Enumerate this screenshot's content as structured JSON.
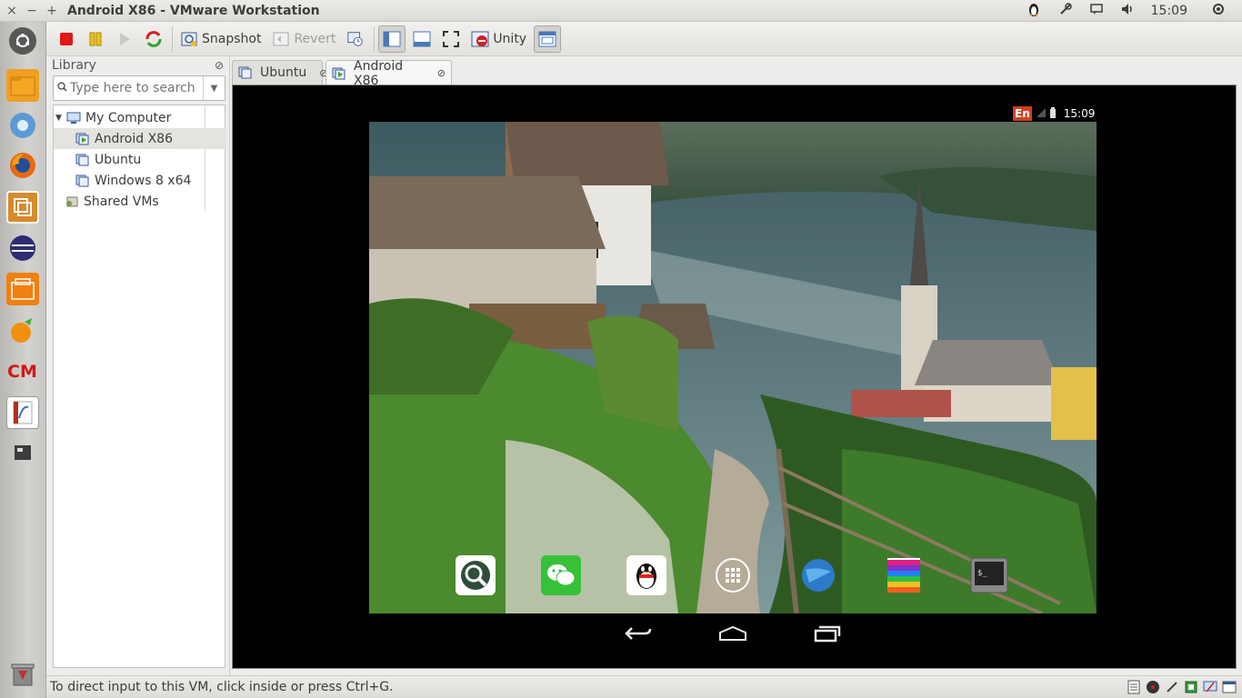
{
  "window": {
    "title": "Android X86 - VMware Workstation",
    "controls": [
      "×",
      "−",
      "+"
    ]
  },
  "tray": {
    "clock": "15:09"
  },
  "toolbar": {
    "snapshot_label": "Snapshot",
    "revert_label": "Revert",
    "unity_label": "Unity"
  },
  "library": {
    "title": "Library",
    "search_placeholder": "Type here to search",
    "tree": {
      "root": "My Computer",
      "vms": [
        "Android X86",
        "Ubuntu",
        "Windows 8 x64"
      ],
      "shared": "Shared VMs"
    }
  },
  "tabs": [
    {
      "label": "Ubuntu"
    },
    {
      "label": "Android X86"
    }
  ],
  "android": {
    "input_indicator": "En",
    "clock": "15:09"
  },
  "statusline": {
    "message": "To direct input to this VM, click inside or press Ctrl+G."
  }
}
